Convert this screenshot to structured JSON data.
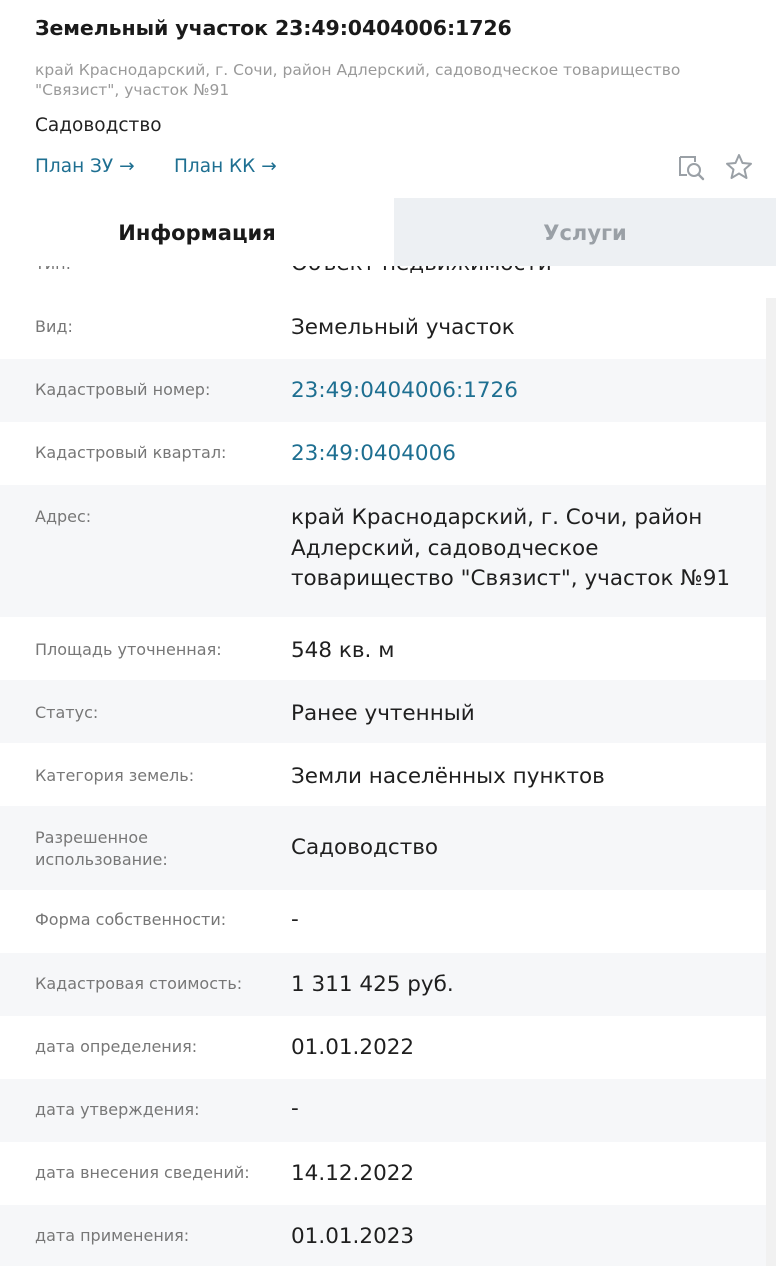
{
  "header": {
    "title": "Земельный участок 23:49:0404006:1726",
    "address": "край Краснодарский, г. Сочи, район Адлерский, садоводческое товарищество \"Связист\", участок №91",
    "purpose": "Садоводство",
    "link_plan_zu": "План ЗУ →",
    "link_plan_kk": "План КК →",
    "icon_search": "document-search-icon",
    "icon_star": "star-icon"
  },
  "tabs": {
    "info": "Информация",
    "services": "Услуги"
  },
  "rows": [
    {
      "label": "Тип:",
      "value": "Объект недвижимости"
    },
    {
      "label": "Вид:",
      "value": "Земельный участок"
    },
    {
      "label": "Кадастровый номер:",
      "value": "23:49:0404006:1726"
    },
    {
      "label": "Кадастровый квартал:",
      "value": "23:49:0404006"
    },
    {
      "label": "Адрес:",
      "value": "край Краснодарский, г. Сочи, район Адлерский, садоводческое товарищество \"Связист\", участок №91"
    },
    {
      "label": "Площадь уточненная:",
      "value": "548 кв. м"
    },
    {
      "label": "Статус:",
      "value": "Ранее учтенный"
    },
    {
      "label": "Категория земель:",
      "value": "Земли населённых пунктов"
    },
    {
      "label": "Разрешенное использование:",
      "value": "Садоводство"
    },
    {
      "label": "Форма собственности:",
      "value": "-"
    },
    {
      "label": "Кадастровая стоимость:",
      "value": "1 311 425 руб."
    },
    {
      "label": "дата определения:",
      "value": "01.01.2022"
    },
    {
      "label": "дата утверждения:",
      "value": "-"
    },
    {
      "label": "дата внесения сведений:",
      "value": "14.12.2022"
    },
    {
      "label": "дата применения:",
      "value": "01.01.2023"
    }
  ],
  "colors": {
    "link": "#1e6f91",
    "alt_row": "#f6f7f9",
    "inactive_tab": "#edf0f3"
  }
}
